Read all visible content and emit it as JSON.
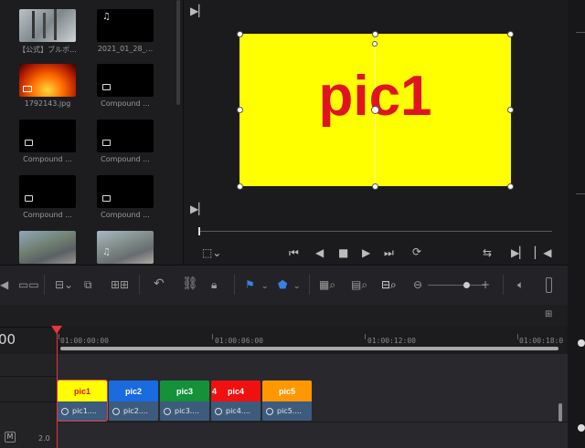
{
  "media_pool": {
    "clips": [
      {
        "name": "【公式】ブルボ...",
        "thumb": "photo-grey",
        "icon": ""
      },
      {
        "name": "2021_01_28_...",
        "thumb": "black",
        "icon": "music-note-icon"
      },
      {
        "name": "1792143.jpg",
        "thumb": "fire",
        "icon": "image-icon"
      },
      {
        "name": "Compound ...",
        "thumb": "black",
        "icon": "compound-clip-icon"
      },
      {
        "name": "Compound ...",
        "thumb": "black",
        "icon": "compound-clip-icon"
      },
      {
        "name": "Compound ...",
        "thumb": "black",
        "icon": "compound-clip-icon"
      },
      {
        "name": "Compound ...",
        "thumb": "black",
        "icon": "compound-clip-icon"
      },
      {
        "name": "Compound ...",
        "thumb": "black",
        "icon": "compound-clip-icon"
      },
      {
        "name": "",
        "thumb": "photo-town",
        "icon": ""
      },
      {
        "name": "",
        "thumb": "photo-town",
        "icon": "music-note-icon"
      }
    ]
  },
  "viewer": {
    "canvas_text": "pic1",
    "canvas_color": "#ffff00",
    "text_color": "#e0141e"
  },
  "timeline": {
    "timecode": "00",
    "ruler_labels": [
      "01:00:00:00",
      "01:00:06:00",
      "01:00:12:00",
      "01:00:18:0"
    ],
    "clips": [
      {
        "title": "pic1",
        "label": "pic1....",
        "color": "#ffff00",
        "text_color": "#e0141e",
        "selected": true
      },
      {
        "title": "pic2",
        "label": "pic2....",
        "color": "#1a6ae0",
        "text_color": "#ffffff",
        "selected": false
      },
      {
        "title": "pic3",
        "label": "pic3....",
        "color": "#15913a",
        "text_color": "#ffffff",
        "selected": false
      },
      {
        "title": "pic4",
        "label": "pic4....",
        "color": "#f01010",
        "text_color": "#ffffff",
        "selected": false,
        "prefix": "4"
      },
      {
        "title": "pic5",
        "label": "pic5....",
        "color": "#ff9800",
        "text_color": "#ffffff",
        "selected": false
      }
    ],
    "track_badge": "M",
    "track_value": "2.0"
  }
}
